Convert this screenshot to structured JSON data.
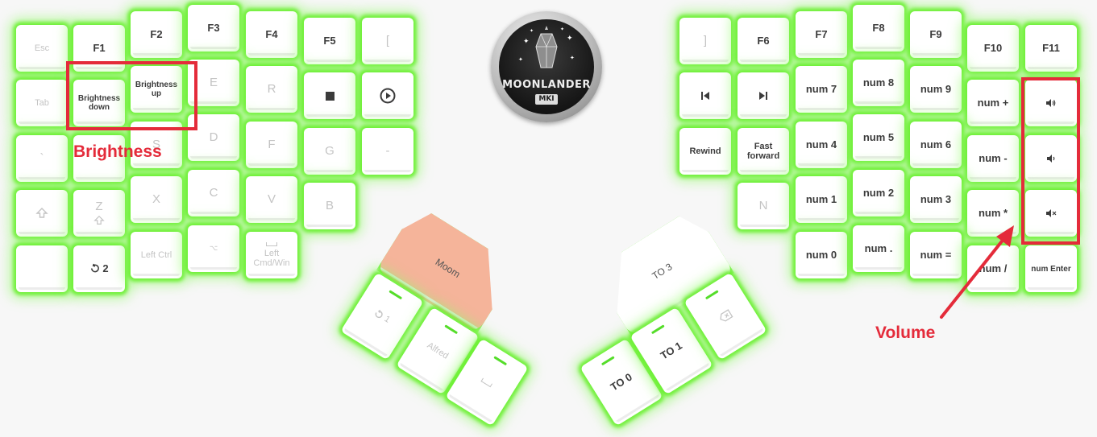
{
  "logo": {
    "title": "MOONLANDER",
    "subtitle": "MKI"
  },
  "annotations": {
    "brightness": "Brightness",
    "volume": "Volume"
  },
  "left": {
    "esc": "Esc",
    "f1": "F1",
    "f2": "F2",
    "f3": "F3",
    "f4": "F4",
    "f5": "F5",
    "bracket_l": "[",
    "tab": "Tab",
    "brightness_down": "Brightness down",
    "brightness_up": "Brightness up",
    "e": "E",
    "r": "R",
    "backtick": "`",
    "s": "S",
    "d": "D",
    "f": "F",
    "g": "G",
    "minus": "-",
    "z": "Z",
    "x": "X",
    "c": "C",
    "v": "V",
    "b": "B",
    "left_ctrl": "Left Ctrl",
    "alt_symbol": "⌥",
    "left_cmd_win": "Left Cmd/Win",
    "layer_two": "2",
    "thumb_moom": "Moom",
    "thumb_layer_one": "1",
    "thumb_alfred": "Alfred"
  },
  "right": {
    "bracket_r": "]",
    "f6": "F6",
    "f7": "F7",
    "f8": "F8",
    "f9": "F9",
    "f10": "F10",
    "f11": "F11",
    "num7": "num 7",
    "num8": "num 8",
    "num9": "num 9",
    "num_plus": "num +",
    "rewind": "Rewind",
    "fast_forward": "Fast forward",
    "num4": "num 4",
    "num5": "num 5",
    "num6": "num 6",
    "num_minus": "num -",
    "n": "N",
    "num1": "num 1",
    "num2": "num 2",
    "num3": "num 3",
    "num_star": "num *",
    "num0": "num 0",
    "num_dot": "num .",
    "num_equal": "num =",
    "num_slash": "num /",
    "num_enter": "num Enter",
    "thumb_to3": "TO 3",
    "thumb_to0": "TO 0",
    "thumb_to1": "TO 1"
  },
  "colors": {
    "glow": "#64ee28",
    "annotation": "#e42b3a",
    "moom_key": "#f5b49a"
  }
}
